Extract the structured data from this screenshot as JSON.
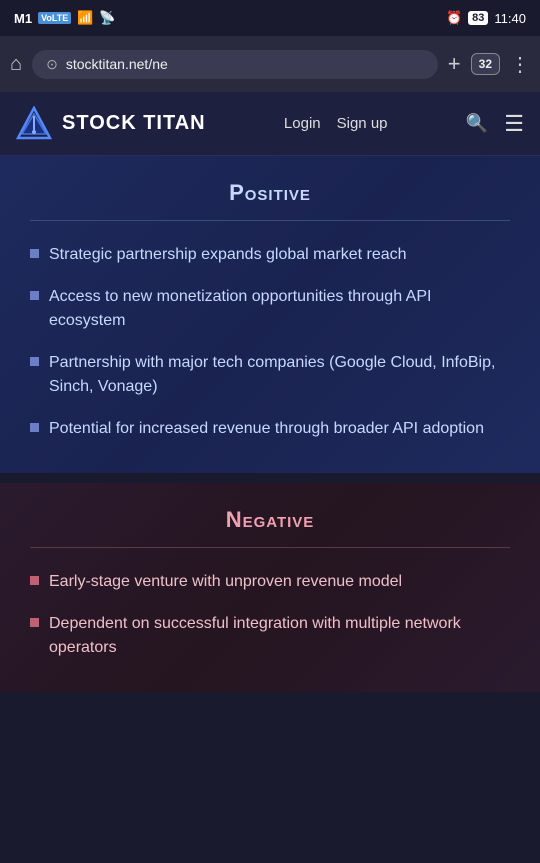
{
  "statusBar": {
    "carrier": "M1",
    "volte": "VoLTE",
    "time": "11:40",
    "battery": "83",
    "alarm_icon": "⏰"
  },
  "browserBar": {
    "url": "stocktitan.net/ne",
    "tabs_count": "32",
    "home_icon": "🏠",
    "add_icon": "+",
    "menu_icon": "⋮"
  },
  "nav": {
    "title": "STOCK TITAN",
    "login_label": "Login",
    "signup_label": "Sign up",
    "search_icon": "🔍",
    "menu_icon": "≡"
  },
  "positive": {
    "title": "Positive",
    "items": [
      "Strategic partnership expands global market reach",
      "Access to new monetization opportunities through API ecosystem",
      "Partnership with major tech companies (Google Cloud, InfoBip, Sinch, Vonage)",
      "Potential for increased revenue through broader API adoption"
    ]
  },
  "negative": {
    "title": "Negative",
    "items": [
      "Early-stage venture with unproven revenue model",
      "Dependent on successful integration with multiple network operators"
    ]
  }
}
